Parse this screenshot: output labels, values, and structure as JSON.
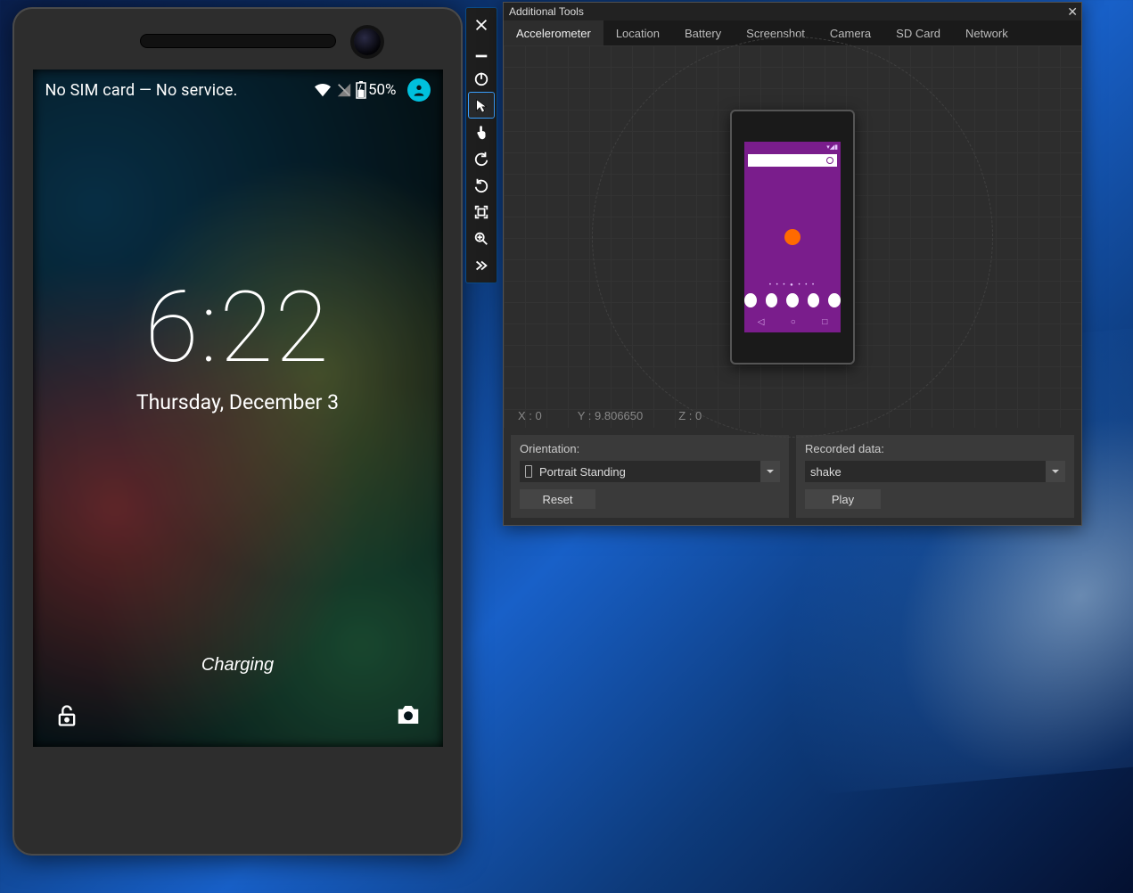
{
  "emulator": {
    "status_text": "No SIM card — No service.",
    "battery_percent": "50%",
    "clock_time": "6:22",
    "clock_date": "Thursday, December 3",
    "charging_label": "Charging"
  },
  "toolbar": {
    "buttons": [
      {
        "name": "close",
        "active": false
      },
      {
        "name": "minimize",
        "active": false
      },
      {
        "name": "power",
        "active": false
      },
      {
        "name": "cursor-single-point",
        "active": true
      },
      {
        "name": "cursor-multi-touch",
        "active": false
      },
      {
        "name": "rotate-left",
        "active": false
      },
      {
        "name": "rotate-right",
        "active": false
      },
      {
        "name": "fit-to-screen",
        "active": false
      },
      {
        "name": "zoom",
        "active": false
      },
      {
        "name": "tools",
        "active": false
      }
    ]
  },
  "panel": {
    "title": "Additional Tools",
    "tabs": [
      "Accelerometer",
      "Location",
      "Battery",
      "Screenshot",
      "Camera",
      "SD Card",
      "Network"
    ],
    "active_tab": "Accelerometer",
    "readout": {
      "x": "X : 0",
      "y": "Y : 9.806650",
      "z": "Z : 0"
    },
    "orientation": {
      "label": "Orientation:",
      "value": "Portrait Standing",
      "reset_button": "Reset"
    },
    "recorded": {
      "label": "Recorded data:",
      "value": "shake",
      "play_button": "Play"
    }
  }
}
